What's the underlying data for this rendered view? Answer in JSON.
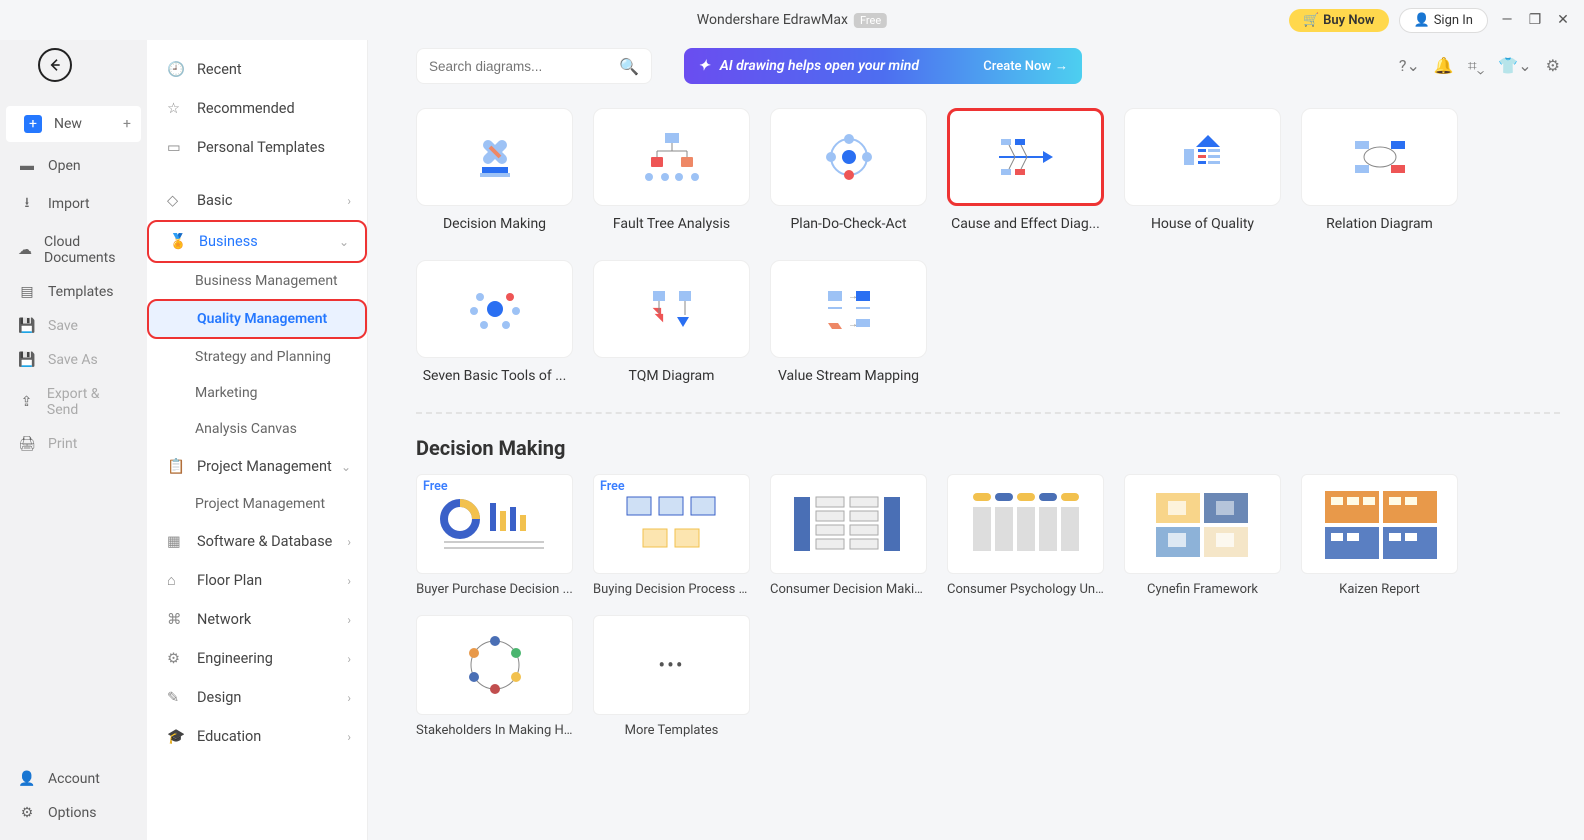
{
  "titlebar": {
    "app_name": "Wondershare EdrawMax",
    "badge": "Free",
    "buy": "Buy Now",
    "signin": "Sign In"
  },
  "left_nav": {
    "new": "New",
    "open": "Open",
    "import": "Import",
    "cloud": "Cloud Documents",
    "templates": "Templates",
    "save": "Save",
    "saveas": "Save As",
    "export": "Export & Send",
    "print": "Print",
    "account": "Account",
    "options": "Options"
  },
  "categories": {
    "recent": "Recent",
    "recommended": "Recommended",
    "personal": "Personal Templates",
    "basic": "Basic",
    "business": "Business",
    "business_subs": {
      "bm": "Business Management",
      "qm": "Quality Management",
      "sp": "Strategy and Planning",
      "mk": "Marketing",
      "ac": "Analysis Canvas"
    },
    "pm": "Project Management",
    "pm_sub": "Project Management",
    "sd": "Software & Database",
    "fp": "Floor Plan",
    "nw": "Network",
    "eng": "Engineering",
    "design": "Design",
    "edu": "Education"
  },
  "search": {
    "placeholder": "Search diagrams..."
  },
  "ai_banner": {
    "text": "AI drawing helps open your mind",
    "cta": "Create Now"
  },
  "diagram_types": {
    "r1": [
      {
        "label": "Decision Making"
      },
      {
        "label": "Fault Tree Analysis"
      },
      {
        "label": "Plan-Do-Check-Act"
      },
      {
        "label": "Cause and Effect Diag...",
        "highlight": true
      },
      {
        "label": "House of Quality"
      },
      {
        "label": "Relation Diagram"
      }
    ],
    "r2": [
      {
        "label": "Seven Basic Tools of ..."
      },
      {
        "label": "TQM Diagram"
      },
      {
        "label": "Value Stream Mapping"
      }
    ]
  },
  "section_title": "Decision Making",
  "templates_r1": [
    {
      "label": "Buyer Purchase Decision ...",
      "free": true
    },
    {
      "label": "Buying Decision Process O...",
      "free": true
    },
    {
      "label": "Consumer Decision Makin..."
    },
    {
      "label": "Consumer Psychology Un..."
    },
    {
      "label": "Cynefin Framework"
    },
    {
      "label": "Kaizen Report"
    }
  ],
  "templates_r2": [
    {
      "label": "Stakeholders In Making He..."
    },
    {
      "label": "More Templates",
      "more": true
    }
  ],
  "free_tag": "Free"
}
